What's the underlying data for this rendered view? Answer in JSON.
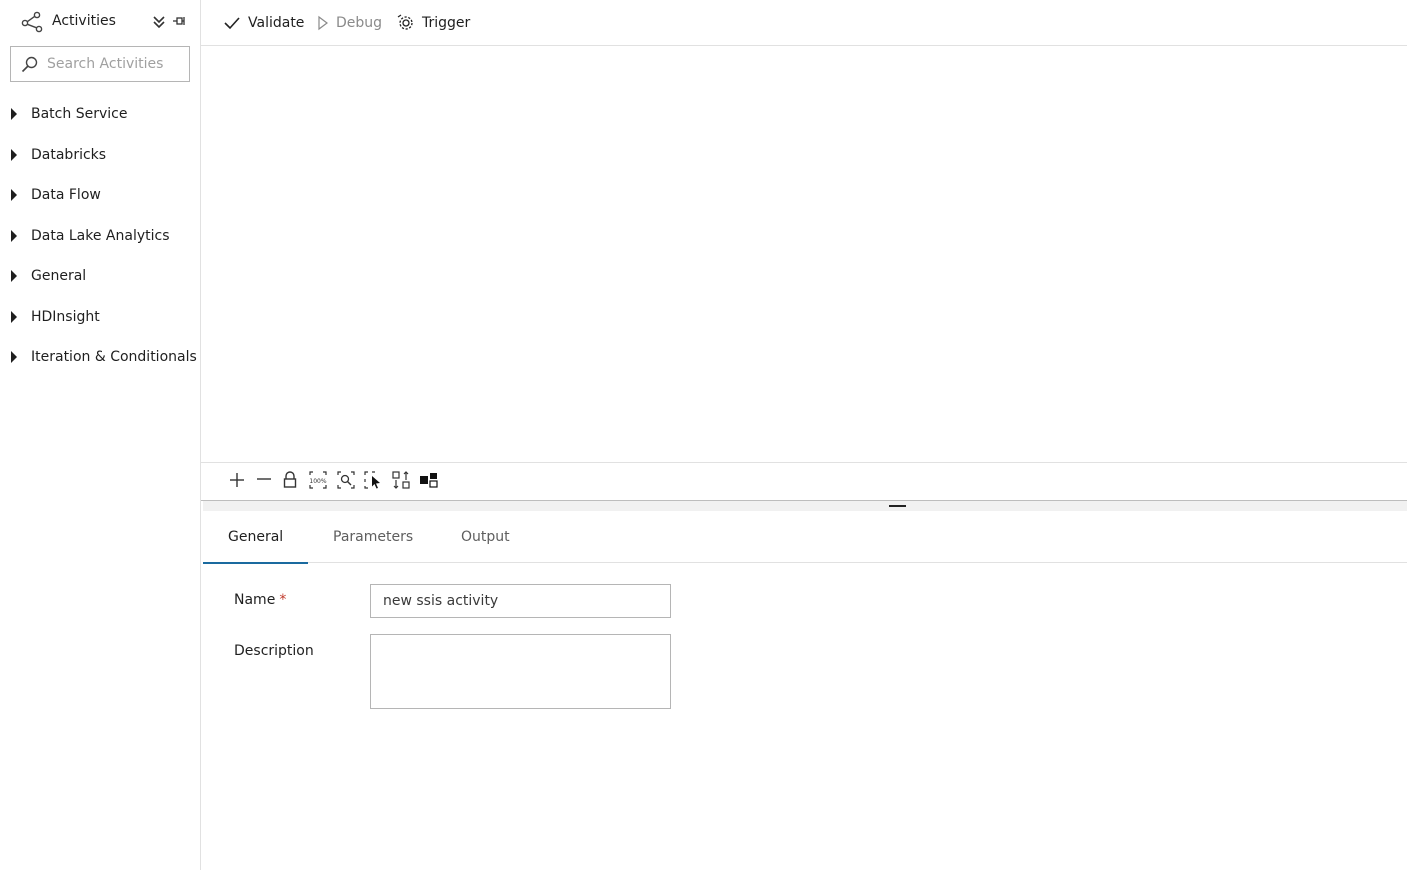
{
  "sidebar": {
    "title": "Activities",
    "search_placeholder": "Search Activities",
    "categories": [
      {
        "label": "Batch Service"
      },
      {
        "label": "Databricks"
      },
      {
        "label": "Data Flow"
      },
      {
        "label": "Data Lake Analytics"
      },
      {
        "label": "General"
      },
      {
        "label": "HDInsight"
      },
      {
        "label": "Iteration & Conditionals"
      }
    ]
  },
  "toolbar": {
    "validate_label": "Validate",
    "debug_label": "Debug",
    "trigger_label": "Trigger"
  },
  "properties": {
    "tabs": [
      {
        "label": "General",
        "active": true
      },
      {
        "label": "Parameters",
        "active": false
      },
      {
        "label": "Output",
        "active": false
      }
    ],
    "name_label": "Name",
    "required_marker": "*",
    "name_value": "new ssis activity",
    "description_label": "Description",
    "description_value": ""
  },
  "colors": {
    "accent": "#1a6a9f",
    "required": "#c0392b",
    "border": "#b5b5b5"
  },
  "icons": {
    "activities": "pipeline-activities-icon",
    "collapse": "double-chevron-down-icon",
    "pin": "pin-icon",
    "search": "search-icon",
    "validate": "checkmark-icon",
    "debug": "play-outline-icon",
    "trigger": "gear-trigger-icon"
  }
}
